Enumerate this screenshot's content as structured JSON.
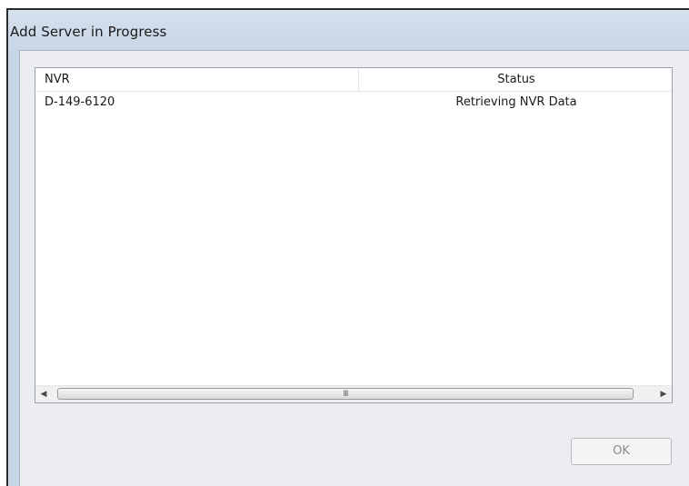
{
  "window": {
    "title": "Add Server in Progress"
  },
  "list": {
    "columns": [
      "NVR",
      "Status"
    ],
    "rows": [
      {
        "nvr": "D-149-6120",
        "status": "Retrieving NVR Data"
      }
    ],
    "scroll_grip": "III"
  },
  "buttons": {
    "ok": "OK"
  }
}
